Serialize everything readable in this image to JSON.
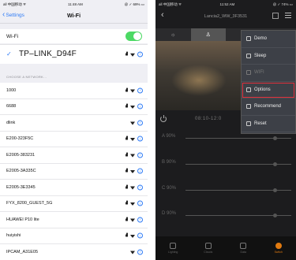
{
  "left": {
    "status": {
      "carrier": "all 中国移动 ᯤ",
      "time": "11:48 AM",
      "battery": "@ ✓ 69% ▭"
    },
    "nav": {
      "back_label": "Settings",
      "title": "Wi-Fi"
    },
    "wifi_label": "Wi-Fi",
    "connected_network": "TP–LINK_D94F",
    "section_header": "CHOOSE A NETWORK...",
    "networks": [
      {
        "name": "1000",
        "locked": true
      },
      {
        "name": "6688",
        "locked": true
      },
      {
        "name": "dlink",
        "locked": false
      },
      {
        "name": "E200-323F5C",
        "locked": true
      },
      {
        "name": "E2005-383231",
        "locked": true
      },
      {
        "name": "E2005-3A335C",
        "locked": true
      },
      {
        "name": "E2005-3E3345",
        "locked": true
      },
      {
        "name": "FYX_8200_GUEST_5G",
        "locked": true
      },
      {
        "name": "HUAWEI P10 lite",
        "locked": true
      },
      {
        "name": "huiyishi",
        "locked": true
      },
      {
        "name": "IPCAM_A31E05",
        "locked": false
      }
    ]
  },
  "right": {
    "status": {
      "carrier": "all 中国移动 ᯤ",
      "time": "11:52 AM",
      "battery": "@ ✓ 74% ▭"
    },
    "header_title": "Lancia2_WW_3F3531",
    "timer_text": "08:10-12:0",
    "sliders": [
      {
        "label": "A 90%",
        "value": 90
      },
      {
        "label": "B 90%",
        "value": 90
      },
      {
        "label": "C 90%",
        "value": 90
      },
      {
        "label": "D 90%",
        "value": 90
      }
    ],
    "menu": [
      {
        "label": "Demo",
        "disabled": false,
        "highlighted": false
      },
      {
        "label": "Sleep",
        "disabled": false,
        "highlighted": false
      },
      {
        "label": "WIFI",
        "disabled": true,
        "highlighted": false
      },
      {
        "label": "Options",
        "disabled": false,
        "highlighted": true
      },
      {
        "label": "Recommend",
        "disabled": false,
        "highlighted": false
      },
      {
        "label": "Reset",
        "disabled": false,
        "highlighted": false
      }
    ],
    "bottom_nav": [
      "Lighting",
      "Clouds",
      "Data",
      "Switch"
    ],
    "colors": {
      "accent": "#e07a10",
      "highlight_border": "#e0303a",
      "toggle_on": "#4cd964",
      "link_blue": "#2f7cf6"
    }
  }
}
